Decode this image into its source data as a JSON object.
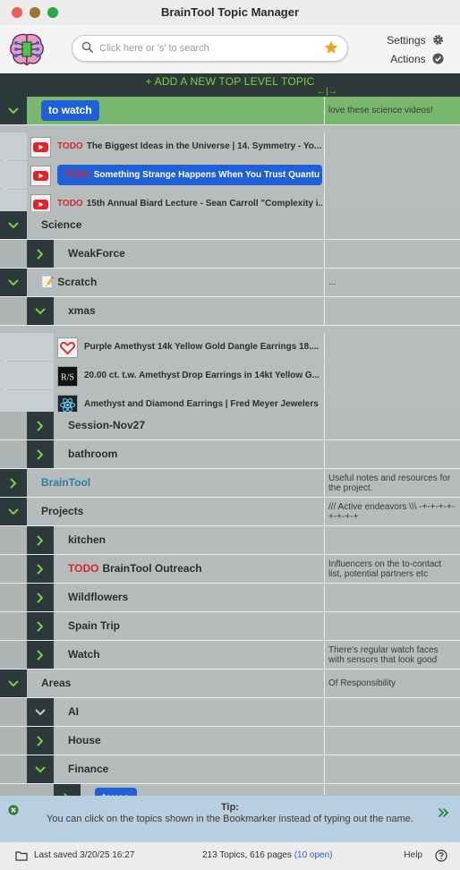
{
  "window": {
    "title": "BrainTool Topic Manager",
    "traffic_colors": [
      "#ec5f57",
      "#a0732e",
      "#2aa745"
    ]
  },
  "header": {
    "search_placeholder": "Click here or 's' to search",
    "settings_label": "Settings",
    "actions_label": "Actions"
  },
  "add_topic_label": "+ ADD A NEW TOP LEVEL TOPIC",
  "rows": [
    {
      "kind": "topic",
      "indent": 0,
      "state": "open",
      "label": "to watch",
      "pill": true,
      "note": "love these science videos!",
      "bg": "sel"
    },
    {
      "kind": "page",
      "indent": 1,
      "icon": "youtube-icon",
      "todo": "TODO",
      "label": "The Biggest Ideas in the Universe | 14. Symmetry - Yo...",
      "note": "",
      "bg": "light"
    },
    {
      "kind": "page",
      "indent": 1,
      "icon": "youtube-icon",
      "todo": "TODO",
      "label": "Something Strange Happens When You Trust Quantu",
      "pill": true,
      "note": "",
      "bg": "light"
    },
    {
      "kind": "page",
      "indent": 1,
      "icon": "youtube-icon",
      "todo": "TODO",
      "label": "15th Annual Biard Lecture - Sean Carroll \"Complexity i...",
      "note": "",
      "bg": "light"
    },
    {
      "kind": "topic",
      "indent": 0,
      "state": "open",
      "label": "Science",
      "note": "",
      "bg": "dark"
    },
    {
      "kind": "topic",
      "indent": 1,
      "state": "closed",
      "label": "WeakForce",
      "note": "",
      "bg": "dark"
    },
    {
      "kind": "topic",
      "indent": 0,
      "state": "open",
      "label": "📝 Scratch",
      "note": "...",
      "bg": "dark"
    },
    {
      "kind": "topic",
      "indent": 1,
      "state": "open",
      "label": "xmas",
      "note": "",
      "bg": "dark"
    },
    {
      "kind": "page",
      "indent": 2,
      "icon": "heart-icon",
      "todo": "",
      "label": "Purple Amethyst 14k Yellow Gold Dangle Earrings 18....",
      "note": "",
      "bg": "light"
    },
    {
      "kind": "page",
      "indent": 2,
      "icon": "rs-logo-icon",
      "todo": "",
      "label": "20.00 ct. t.w. Amethyst Drop Earrings in 14kt Yellow G...",
      "note": "",
      "bg": "light"
    },
    {
      "kind": "page",
      "indent": 2,
      "icon": "react-icon",
      "todo": "",
      "label": "Amethyst and Diamond Earrings | Fred Meyer Jewelers",
      "note": "",
      "bg": "light"
    },
    {
      "kind": "topic",
      "indent": 1,
      "state": "closed",
      "label": "Session-Nov27",
      "note": "",
      "bg": "dark"
    },
    {
      "kind": "topic",
      "indent": 1,
      "state": "closed",
      "label": "bathroom",
      "note": "",
      "bg": "dark"
    },
    {
      "kind": "topic",
      "indent": 0,
      "state": "closed",
      "label": "BrainTool",
      "link": true,
      "note": "Useful notes and resources for the project.",
      "bg": "dark"
    },
    {
      "kind": "topic",
      "indent": 0,
      "state": "open",
      "label": "Projects",
      "note": "/// Active endeavors \\\\\\ -+-+-+-+-+-+-+-+",
      "bg": "dark"
    },
    {
      "kind": "topic",
      "indent": 1,
      "state": "closed",
      "label": "kitchen",
      "note": "",
      "bg": "dark"
    },
    {
      "kind": "topic",
      "indent": 1,
      "state": "closed",
      "todo": "TODO",
      "label": "BrainTool Outreach",
      "note": "Influencers on the to-contact list, potential partners etc",
      "bg": "dark"
    },
    {
      "kind": "topic",
      "indent": 1,
      "state": "closed",
      "label": "Wildflowers",
      "note": "",
      "bg": "dark"
    },
    {
      "kind": "topic",
      "indent": 1,
      "state": "closed",
      "label": "Spain Trip",
      "note": "",
      "bg": "dark"
    },
    {
      "kind": "topic",
      "indent": 1,
      "state": "closed",
      "label": "Watch",
      "note": "There's regular watch faces with sensors that look good",
      "bg": "dark"
    },
    {
      "kind": "topic",
      "indent": 0,
      "state": "open",
      "label": "Areas",
      "note": "Of Responsibility",
      "bg": "dark"
    },
    {
      "kind": "topic",
      "indent": 1,
      "state": "open-grey",
      "label": "AI",
      "note": "",
      "bg": "dark"
    },
    {
      "kind": "topic",
      "indent": 1,
      "state": "closed",
      "label": "House",
      "note": "",
      "bg": "dark"
    },
    {
      "kind": "topic",
      "indent": 1,
      "state": "open",
      "label": "Finance",
      "note": "",
      "bg": "dark"
    },
    {
      "kind": "topic",
      "indent": 2,
      "state": "closed",
      "label": "taxes",
      "pill": true,
      "note": "",
      "bg": "dark"
    },
    {
      "kind": "topic",
      "indent": 2,
      "state": "closed",
      "label": "",
      "note": "",
      "bg": "dark"
    }
  ],
  "tip": {
    "title": "Tip:",
    "text": "You can click on the topics shown in the Bookmarker instead of typing out the name."
  },
  "footer": {
    "saved": "Last saved 3/20/25 16:27",
    "stats": "213 Topics, 616 pages",
    "open": "(10 open)",
    "help": "Help"
  },
  "colors": {
    "accent_green": "#7ecf3b",
    "selection_blue": "#1f5fd8",
    "todo_red": "#d62828",
    "selected_row": "#7ab76e",
    "dark_cell": "#2d3a3b"
  }
}
